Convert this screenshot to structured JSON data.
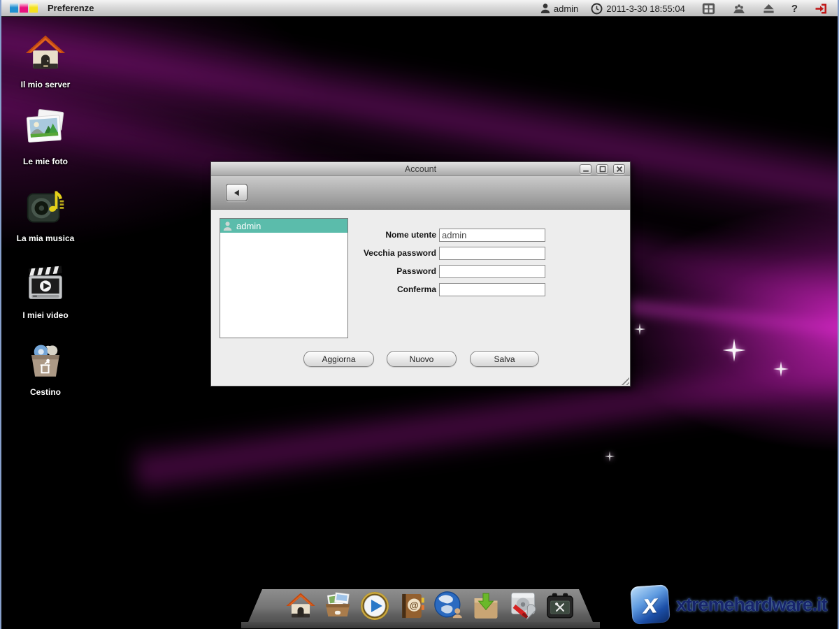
{
  "topbar": {
    "menu": "Preferenze",
    "username": "admin",
    "datetime": "2011-3-30 18:55:04",
    "help": "?"
  },
  "desktop_icons": {
    "server": "Il mio server",
    "photos": "Le mie foto",
    "music": "La mia musica",
    "videos": "I miei video",
    "trash": "Cestino"
  },
  "account_window": {
    "title": "Account",
    "user_list": {
      "selected_user": "admin"
    },
    "fields": {
      "username_label": "Nome utente",
      "username_value": "admin",
      "old_password_label": "Vecchia password",
      "old_password_value": "",
      "password_label": "Password",
      "password_value": "",
      "confirm_label": "Conferma",
      "confirm_value": ""
    },
    "buttons": {
      "update": "Aggiorna",
      "new": "Nuovo",
      "save": "Salva"
    }
  },
  "dock": {
    "icons": [
      "home-icon",
      "photo-box-icon",
      "media-player-icon",
      "address-book-icon",
      "network-globe-icon",
      "download-folder-icon",
      "disk-utility-icon",
      "backup-device-icon"
    ]
  },
  "watermark": {
    "x_glyph": "x",
    "text": "xtremehardware.it"
  },
  "colors": {
    "selection_teal": "#5bbcab",
    "logout_red": "#c01818",
    "logo_blue": "#1f8fd0",
    "logo_magenta": "#e8137e",
    "logo_yellow": "#f5e11e"
  }
}
